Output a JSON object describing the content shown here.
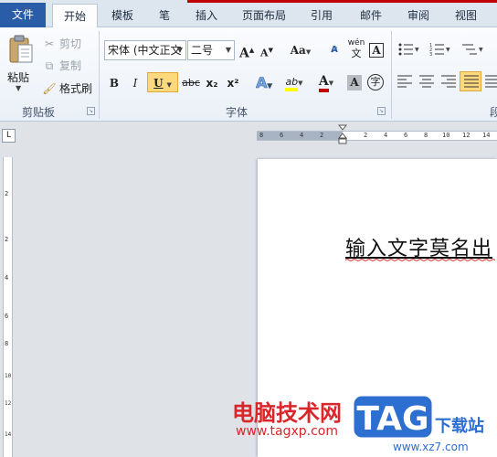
{
  "tabs": [
    {
      "label": "文件"
    },
    {
      "label": "开始"
    },
    {
      "label": "模板"
    },
    {
      "label": "笔"
    },
    {
      "label": "插入"
    },
    {
      "label": "页面布局"
    },
    {
      "label": "引用"
    },
    {
      "label": "邮件"
    },
    {
      "label": "审阅"
    },
    {
      "label": "视图"
    }
  ],
  "clipboard": {
    "paste_label": "粘贴",
    "cut_label": "剪切",
    "copy_label": "复制",
    "format_painter_label": "格式刷",
    "group_label": "剪贴板"
  },
  "font": {
    "font_name": "宋体 (中文正文",
    "font_size": "二号",
    "grow_label": "A",
    "shrink_label": "A",
    "case_label": "Aa",
    "bold_label": "B",
    "italic_label": "I",
    "underline_label": "U",
    "strike_label": "abc",
    "subscript_label": "x₂",
    "superscript_label": "x²",
    "effects_label": "A",
    "highlight_label": "ab",
    "color_label": "A",
    "shading_label": "A",
    "enclose_label": "字",
    "pinyin_label": "wén",
    "border_label": "A",
    "group_label": "字体"
  },
  "paragraph": {
    "group_label": "段"
  },
  "colors": {
    "accent": "#2a5da8",
    "highlight": "#ffff00",
    "font_color": "#c00000",
    "watermark_red": "#d9262b",
    "watermark_blue": "#2d6fd0"
  },
  "ruler": {
    "h_labels": [
      "8",
      "6",
      "4",
      "2",
      "2",
      "4",
      "6",
      "8",
      "10",
      "12",
      "14"
    ],
    "v_labels": [
      "2",
      "2",
      "4",
      "6",
      "8",
      "10",
      "12",
      "14"
    ],
    "corner_label": "L"
  },
  "document": {
    "text": "输入文字莫名出"
  },
  "watermark": {
    "site_cn": "电脑技术网",
    "site_url": "www.tagxp.com",
    "tag_logo": "TAG",
    "site2_cn": "下载站",
    "site2_url": "www.xz7.com"
  }
}
